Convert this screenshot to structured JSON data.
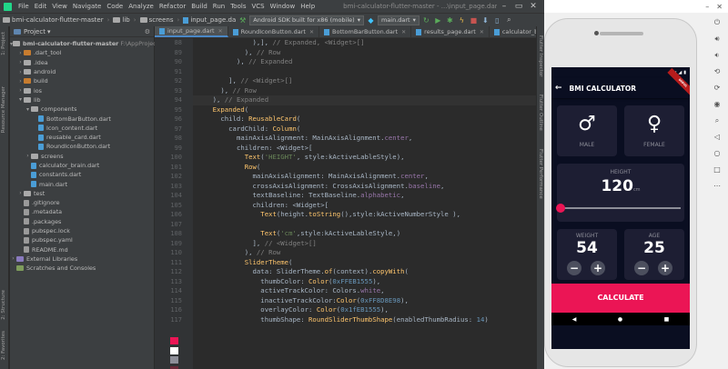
{
  "menubar": {
    "items": [
      "File",
      "Edit",
      "View",
      "Navigate",
      "Code",
      "Analyze",
      "Refactor",
      "Build",
      "Run",
      "Tools",
      "VCS",
      "Window",
      "Help"
    ],
    "window_title": "bmi-calculator-flutter-master - ...\\input_page.dart"
  },
  "toolbar": {
    "breadcrumb": [
      "bmi-calculator-flutter-master",
      "lib",
      "screens",
      "input_page.da"
    ],
    "device_combo": "Android SDK built for x86 (mobile)",
    "run_config": "main.dart"
  },
  "left_strip": {
    "labels": [
      "1: Project",
      "Resource Manager",
      "2: Structure",
      "2: Favorites"
    ]
  },
  "right_strip": {
    "labels": [
      "Flutter Inspector",
      "Flutter Outline",
      "Flutter Performance"
    ]
  },
  "project_panel": {
    "title": "Project",
    "root": "bmi-calculator-flutter-master",
    "root_path": "F:\\AppProjects\\bi",
    "items": [
      {
        "label": ".dart_tool",
        "icon": "folder-orange-icon"
      },
      {
        "label": ".idea",
        "icon": "folder-icon"
      },
      {
        "label": "android",
        "icon": "folder-icon"
      },
      {
        "label": "build",
        "icon": "folder-orange-icon"
      },
      {
        "label": "ios",
        "icon": "folder-icon"
      },
      {
        "label": "lib",
        "icon": "folder-icon"
      },
      {
        "label": "components",
        "icon": "folder-icon"
      },
      {
        "label": "BottomBarButton.dart",
        "icon": "dart-file-icon"
      },
      {
        "label": "Icon_content.dart",
        "icon": "dart-file-icon"
      },
      {
        "label": "reusable_card.dart",
        "icon": "dart-file-icon"
      },
      {
        "label": "RoundIconButton.dart",
        "icon": "dart-file-icon"
      },
      {
        "label": "screens",
        "icon": "folder-icon"
      },
      {
        "label": "calculator_brain.dart",
        "icon": "dart-file-icon"
      },
      {
        "label": "constants.dart",
        "icon": "dart-file-icon"
      },
      {
        "label": "main.dart",
        "icon": "dart-file-icon"
      },
      {
        "label": "test",
        "icon": "folder-icon"
      },
      {
        "label": ".gitignore",
        "icon": "file-icon"
      },
      {
        "label": ".metadata",
        "icon": "file-icon"
      },
      {
        "label": ".packages",
        "icon": "file-icon"
      },
      {
        "label": "pubspec.lock",
        "icon": "file-icon"
      },
      {
        "label": "pubspec.yaml",
        "icon": "file-icon"
      },
      {
        "label": "README.md",
        "icon": "file-icon"
      },
      {
        "label": "External Libraries",
        "icon": "library-icon"
      },
      {
        "label": "Scratches and Consoles",
        "icon": "scratches-icon"
      }
    ]
  },
  "editor": {
    "tabs": [
      "input_page.dart",
      "RoundIconButton.dart",
      "BottomBarButton.dart",
      "results_page.dart",
      "calculator_brain.dart"
    ],
    "lines": [
      {
        "n": "88",
        "text": "              ),], // Expanded, <Widget>[]"
      },
      {
        "n": "89",
        "text": "            ), // Row"
      },
      {
        "n": "90",
        "text": "          ), // Expanded"
      },
      {
        "n": "91",
        "text": ""
      },
      {
        "n": "92",
        "text": "        ], // <Widget>[]"
      },
      {
        "n": "93",
        "text": "      ), // Row"
      },
      {
        "n": "94",
        "text": "    ), // Expanded"
      },
      {
        "n": "95",
        "text": "    Expanded("
      },
      {
        "n": "96",
        "text": "      child: ReusableCard("
      },
      {
        "n": "97",
        "text": "        cardChild: Column("
      },
      {
        "n": "98",
        "text": "          mainAxisAlignment: MainAxisAlignment.center,"
      },
      {
        "n": "99",
        "text": "          children: <Widget>["
      },
      {
        "n": "100",
        "text": "            Text('HEIGHT', style:kActiveLableStyle),"
      },
      {
        "n": "101",
        "text": "            Row("
      },
      {
        "n": "102",
        "text": "              mainAxisAlignment: MainAxisAlignment.center,"
      },
      {
        "n": "103",
        "text": "              crossAxisAlignment: CrossAxisAlignment.baseline,"
      },
      {
        "n": "104",
        "text": "              textBaseline: TextBaseline.alphabetic,"
      },
      {
        "n": "105",
        "text": "              children: <Widget>["
      },
      {
        "n": "106",
        "text": "                Text(height.toString(),style:kActiveNumberStyle ),"
      },
      {
        "n": "107",
        "text": ""
      },
      {
        "n": "108",
        "text": "                Text('cm',style:kActiveLableStyle,)"
      },
      {
        "n": "109",
        "text": "              ], // <Widget>[]"
      },
      {
        "n": "110",
        "text": "            ), // Row"
      },
      {
        "n": "111",
        "text": "            SliderTheme("
      },
      {
        "n": "112",
        "text": "              data: SliderTheme.of(context).copyWith("
      },
      {
        "n": "113",
        "text": "                thumbColor: Color(0xFFEB1555),"
      },
      {
        "n": "114",
        "text": "                activeTrackColor: Colors.white,"
      },
      {
        "n": "115",
        "text": "                inactiveTrackColor:Color(0xFF8D8E98),"
      },
      {
        "n": "116",
        "text": "                overlayColor: Color(0x1fEB1555),"
      },
      {
        "n": "117",
        "text": "                thumbShape: RoundSliderThumbShape(enabledThumbRadius: 14)"
      }
    ]
  },
  "colors": {
    "accent": "#eb1555",
    "card": "#1d1e33",
    "bg": "#0a0e21",
    "inactive": "#8d8e98"
  },
  "app": {
    "title": "BMI CALCULATOR",
    "male_label": "MALE",
    "female_label": "FEMALE",
    "height_label": "HEIGHT",
    "height_value": "120",
    "height_unit": "cm",
    "height_slider_fraction": 0.0,
    "weight_label": "WEIGHT",
    "weight_value": "54",
    "age_label": "AGE",
    "age_value": "25",
    "minus": "−",
    "plus": "+",
    "calculate_label": "CALCULATE",
    "debug_banner": "DEBUG"
  }
}
